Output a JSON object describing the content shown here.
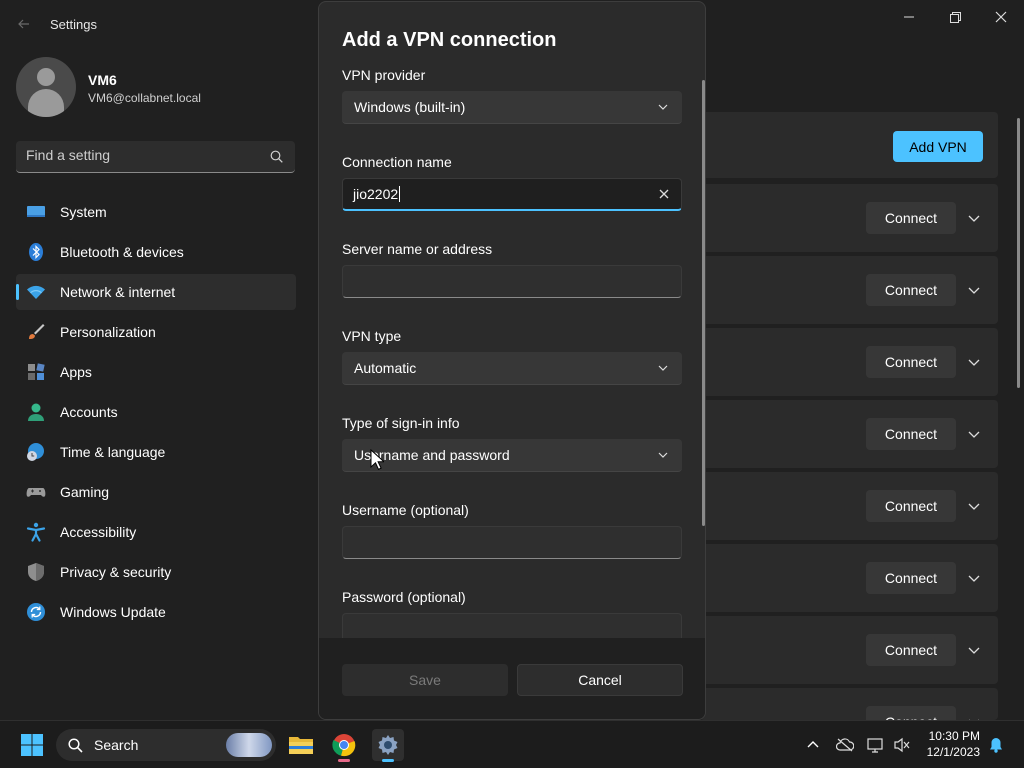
{
  "window": {
    "title": "Settings",
    "controls": [
      "minimize",
      "restore",
      "close"
    ]
  },
  "profile": {
    "name": "VM6",
    "email": "VM6@collabnet.local"
  },
  "search": {
    "placeholder": "Find a setting"
  },
  "sidebar": {
    "items": [
      {
        "label": "System",
        "icon": "system-icon",
        "active": false
      },
      {
        "label": "Bluetooth & devices",
        "icon": "bluetooth-icon",
        "active": false
      },
      {
        "label": "Network & internet",
        "icon": "wifi-icon",
        "active": true
      },
      {
        "label": "Personalization",
        "icon": "brush-icon",
        "active": false
      },
      {
        "label": "Apps",
        "icon": "apps-icon",
        "active": false
      },
      {
        "label": "Accounts",
        "icon": "person-icon",
        "active": false
      },
      {
        "label": "Time & language",
        "icon": "globe-clock-icon",
        "active": false
      },
      {
        "label": "Gaming",
        "icon": "gamepad-icon",
        "active": false
      },
      {
        "label": "Accessibility",
        "icon": "accessibility-icon",
        "active": false
      },
      {
        "label": "Privacy & security",
        "icon": "shield-icon",
        "active": false
      },
      {
        "label": "Windows Update",
        "icon": "update-icon",
        "active": false
      }
    ]
  },
  "background": {
    "add_vpn_label": "Add VPN",
    "connect_label": "Connect",
    "row_count": 8
  },
  "dialog": {
    "title": "Add a VPN connection",
    "vpn_provider": {
      "label": "VPN provider",
      "value": "Windows (built-in)"
    },
    "connection_name": {
      "label": "Connection name",
      "value": "jio2202"
    },
    "server": {
      "label": "Server name or address",
      "value": ""
    },
    "vpn_type": {
      "label": "VPN type",
      "value": "Automatic"
    },
    "signin_type": {
      "label": "Type of sign-in info",
      "value": "Username and password"
    },
    "username": {
      "label": "Username (optional)",
      "value": ""
    },
    "password": {
      "label": "Password (optional)",
      "value": ""
    },
    "save_label": "Save",
    "cancel_label": "Cancel"
  },
  "taskbar": {
    "search_label": "Search",
    "time": "10:30 PM",
    "date": "12/1/2023",
    "colors": {
      "accent": "#4cc2ff",
      "chrome_indicator": "#e86a8a"
    }
  }
}
